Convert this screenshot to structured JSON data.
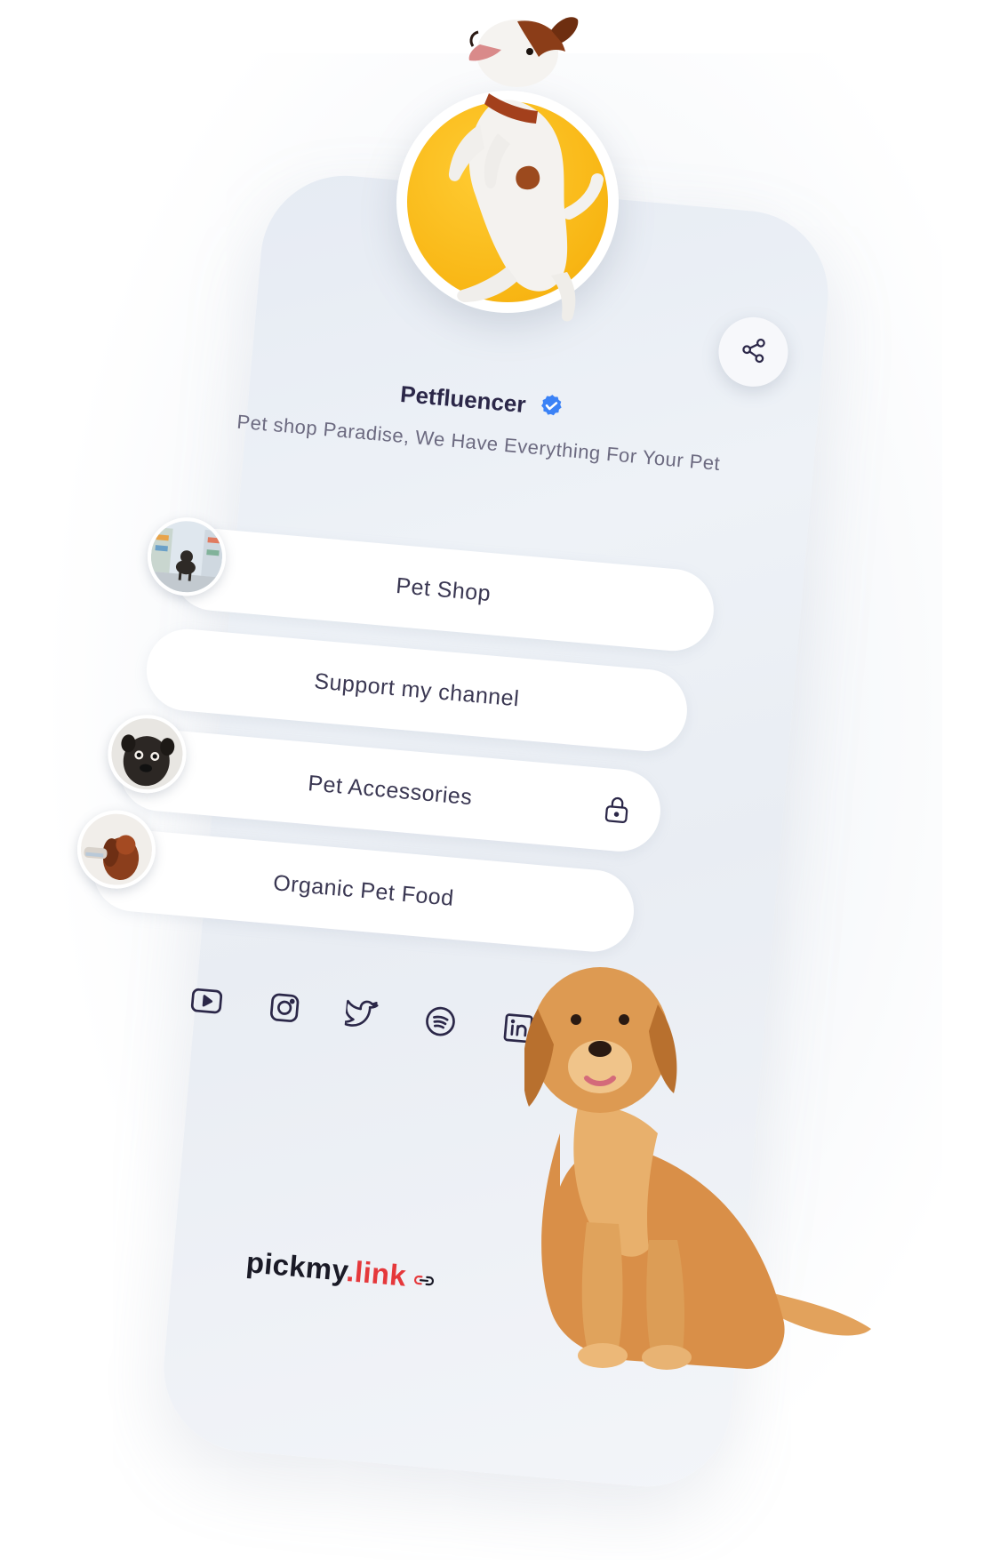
{
  "profile": {
    "name": "Petfluencer",
    "bio": "Pet shop Paradise, We Have Everything For Your Pet",
    "verified": true
  },
  "links": [
    {
      "label": "Pet Shop",
      "thumbnail": "pet-shop-photo",
      "locked": false
    },
    {
      "label": "Support my channel",
      "thumbnail": null,
      "locked": false
    },
    {
      "label": "Pet Accessories",
      "thumbnail": "pug-photo",
      "locked": true
    },
    {
      "label": "Organic Pet Food",
      "thumbnail": "spaniel-photo",
      "locked": false
    }
  ],
  "socials": [
    "youtube-icon",
    "instagram-icon",
    "twitter-icon",
    "spotify-icon",
    "linkedin-icon"
  ],
  "brand": {
    "name_part": "pickmy",
    "accent_part": ".link"
  },
  "colors": {
    "accent": "#e5383b",
    "avatar_bg": "#f8b614",
    "verified_badge": "#3b82f6",
    "text_dark": "#2b2748"
  }
}
